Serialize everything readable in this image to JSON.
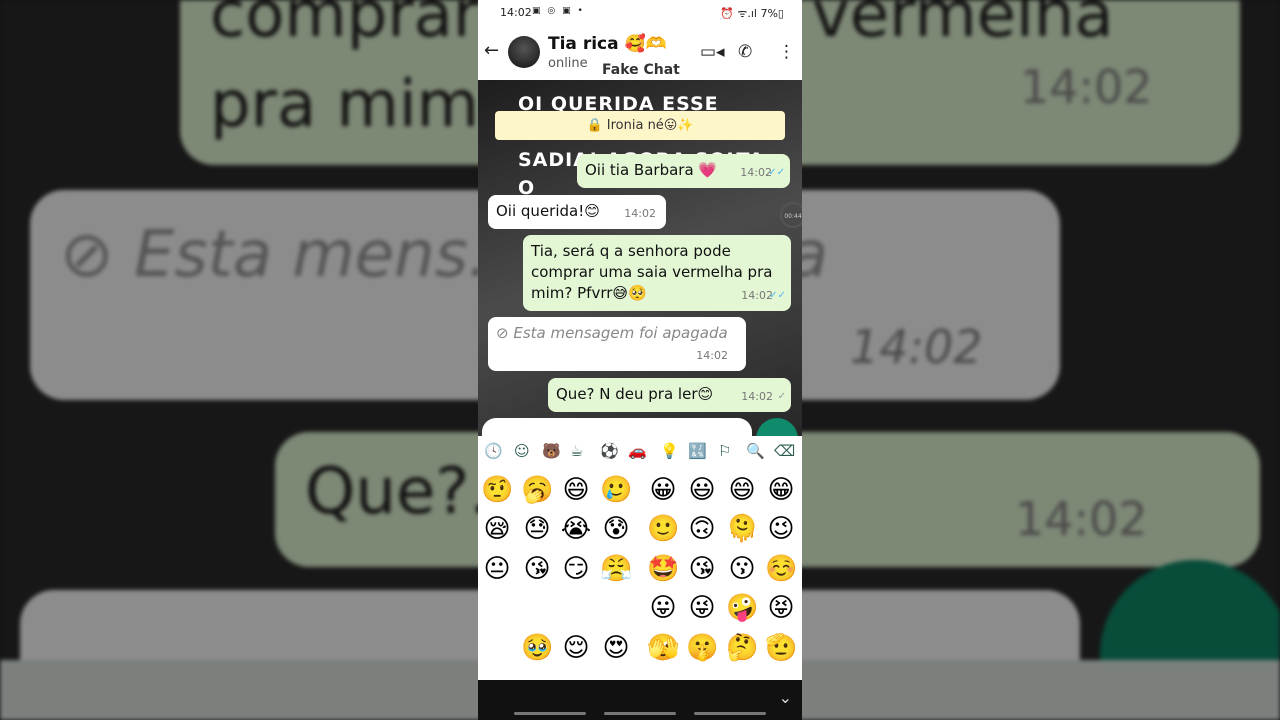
{
  "background": {
    "bubble1_text": "comprar uma saia vermelha pra mim? Pfv",
    "bubble1_time": "14:02",
    "bubble2_text": "⊘ Esta mens... apagada",
    "bubble2_time": "14:02",
    "bubble3_text": "Que?... ler😊",
    "bubble3_time": "14:02"
  },
  "statusbar": {
    "time": "14:02",
    "icons": "▣ ◎ ▣ •",
    "battery": "⏰ ᯤ.ıl 7%▯"
  },
  "header": {
    "back_icon": "arrow-left",
    "contact_name": "Tia rica 🥰🫶",
    "status": "online",
    "watermark": "Fake Chat",
    "video_icon": "▭◂",
    "call_icon": "✆",
    "menu_icon": "⋮"
  },
  "chat": {
    "overlay_text": "OI QUERIDA ESSE CELULAR NÃO É SEU. SADIA! AGORA SOLTA O",
    "ticker": "🔒 Ironia né😛✨",
    "messages": [
      {
        "dir": "out",
        "text": "Oii tia Barbara 💗",
        "time": "14:02",
        "ticks": "✓✓"
      },
      {
        "dir": "in",
        "text": "Oii querida!😊",
        "time": "14:02"
      },
      {
        "dir": "out",
        "text": "Tia, será q a senhora pode comprar uma saia vermelha pra mim? Pfvrr😅🥺",
        "time": "14:02",
        "ticks": "✓✓"
      },
      {
        "dir": "in",
        "text": "⊘ Esta mensagem foi apagada",
        "time": "14:02"
      },
      {
        "dir": "out",
        "text": "Que? N deu pra ler😊",
        "time": "14:02",
        "ticks": "✓"
      }
    ],
    "timer": "00:44"
  },
  "emoji_tabs": [
    "🕓",
    "☺",
    "🐻",
    "☕",
    "⚽",
    "🚗",
    "💡",
    "🔣",
    "⚐",
    "🔍",
    "⌫"
  ],
  "emoji_rows": [
    [
      "🤨",
      "🥱",
      "😄",
      "🥲",
      "😀",
      "😃",
      "😄",
      "😁"
    ],
    [
      "😪",
      "😓",
      "😭",
      "😰",
      "🙂",
      "🙃",
      "🫠",
      "😉"
    ],
    [
      "😐",
      "😘",
      "😏",
      "😤",
      "🤩",
      "😘",
      "😗",
      "☺️"
    ],
    [
      "",
      "",
      "",
      "",
      "😛",
      "😜",
      "🤪",
      "😝"
    ],
    [
      "",
      "🥹",
      "😌",
      "😍",
      "🫣",
      "🤫",
      "🤔",
      "🫡"
    ]
  ]
}
